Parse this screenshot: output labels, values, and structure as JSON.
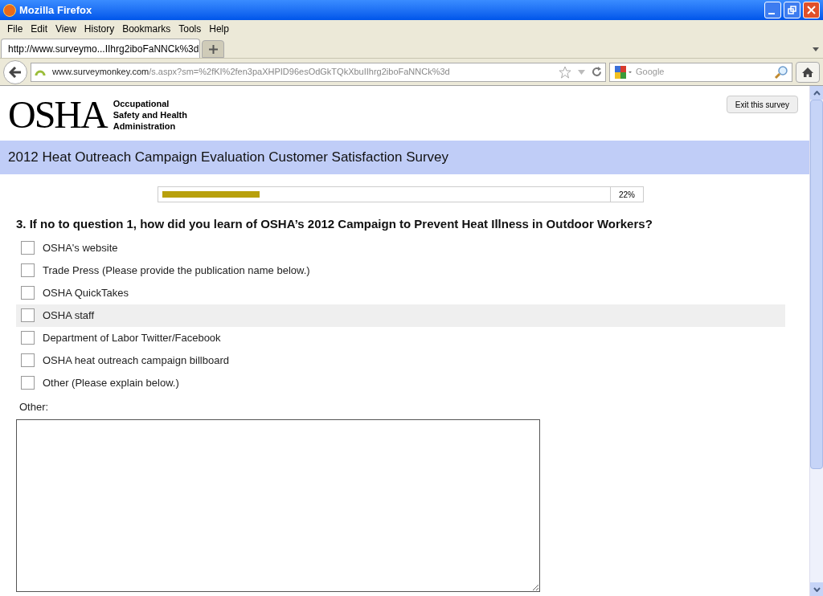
{
  "window": {
    "title": "Mozilla Firefox"
  },
  "menu": [
    "File",
    "Edit",
    "View",
    "History",
    "Bookmarks",
    "Tools",
    "Help"
  ],
  "tab": {
    "label": "http://www.surveymo...IIhrg2iboFaNNCk%3d",
    "selected": true
  },
  "address": {
    "host": "www.surveymonkey.com",
    "path": "/s.aspx?sm=%2fKI%2fen3paXHPID96esOdGkTQkXbuIIhrg2iboFaNNCk%3d"
  },
  "search": {
    "placeholder": "Google"
  },
  "logo": {
    "mark": "OSHA",
    "lines": [
      "Occupational",
      "Safety and Health",
      "Administration"
    ]
  },
  "exit_button": "Exit this survey",
  "survey_title": "2012 Heat Outreach Campaign Evaluation Customer Satisfaction Survey",
  "progress": {
    "level": 0.22,
    "reading": "22%"
  },
  "question": "3. If no to question 1, how did you learn of OSHA’s 2012 Campaign to Prevent Heat Illness in Outdoor Workers?",
  "options": [
    {
      "label": "OSHA's website",
      "checked": false,
      "highlighted": false
    },
    {
      "label": "Trade Press (Please provide the publication name below.)",
      "checked": false,
      "highlighted": false
    },
    {
      "label": "OSHA QuickTakes",
      "checked": false,
      "highlighted": false
    },
    {
      "label": "OSHA staff",
      "checked": false,
      "highlighted": true
    },
    {
      "label": "Department of Labor Twitter/Facebook",
      "checked": false,
      "highlighted": false
    },
    {
      "label": "OSHA heat outreach campaign billboard",
      "checked": false,
      "highlighted": false
    },
    {
      "label": "Other (Please explain below.)",
      "checked": false,
      "highlighted": false
    }
  ],
  "other": {
    "label": "Other:"
  }
}
